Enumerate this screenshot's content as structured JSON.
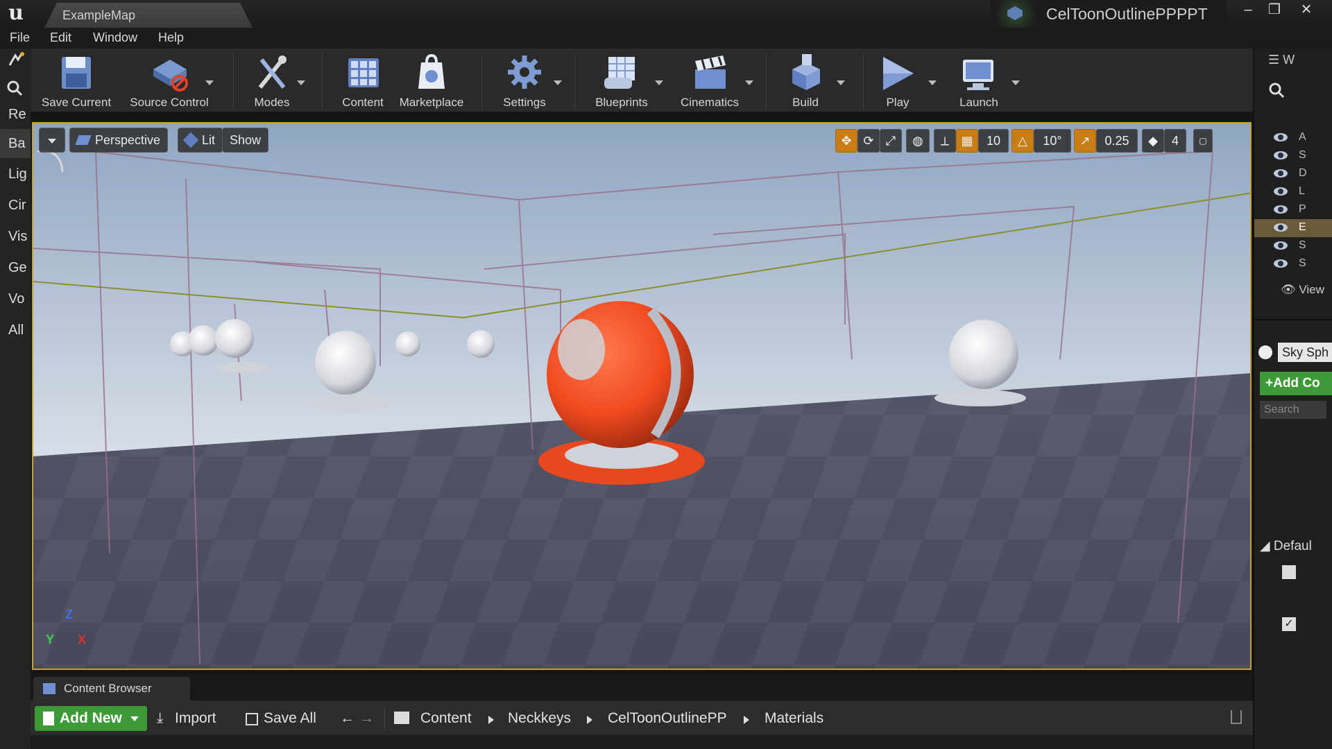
{
  "window": {
    "tab_title": "ExampleMap",
    "project_name": "CelToonOutlinePPPPT",
    "controls": [
      "–",
      "❐",
      "✕"
    ]
  },
  "menu": [
    "File",
    "Edit",
    "Window",
    "Help"
  ],
  "left_panel": {
    "items": [
      "Re",
      "Ba",
      "Lig",
      "Cir",
      "Vis",
      "Ge",
      "Vo",
      "All"
    ],
    "active_index": 1
  },
  "toolbar": {
    "items": [
      {
        "label": "Save Current",
        "icon": "save-icon"
      },
      {
        "label": "Source Control",
        "icon": "source-control-icon"
      },
      {
        "label": "Modes",
        "icon": "modes-icon"
      },
      {
        "label": "Content",
        "icon": "content-icon"
      },
      {
        "label": "Marketplace",
        "icon": "marketplace-icon"
      },
      {
        "label": "Settings",
        "icon": "settings-icon"
      },
      {
        "label": "Blueprints",
        "icon": "blueprints-icon"
      },
      {
        "label": "Cinematics",
        "icon": "cinematics-icon"
      },
      {
        "label": "Build",
        "icon": "build-icon"
      },
      {
        "label": "Play",
        "icon": "play-icon"
      },
      {
        "label": "Launch",
        "icon": "launch-icon"
      }
    ]
  },
  "viewport": {
    "perspective_label": "Perspective",
    "lit_label": "Lit",
    "show_label": "Show",
    "grid_snap": "10",
    "rotation_snap": "10°",
    "scale_snap": "0.25",
    "camera_speed": "4",
    "axis_labels": {
      "z": "Z",
      "y": "Y",
      "x": "X"
    },
    "accent_color": "#c7a12a"
  },
  "right_panel": {
    "header": "W",
    "outliner_rows": [
      "A",
      "S",
      "D",
      "L",
      "P",
      "E",
      "S",
      "S"
    ],
    "selected_row": 5,
    "view_options": "View",
    "selected_actor": "Sky Sph",
    "add_component": "Add Co",
    "search_placeholder": "Search",
    "section": "Defaul"
  },
  "content_browser": {
    "tab_label": "Content Browser",
    "add_new": "Add New",
    "import": "Import",
    "save_all": "Save All",
    "breadcrumbs": [
      "Content",
      "Neckkeys",
      "CelToonOutlinePP",
      "Materials"
    ]
  }
}
